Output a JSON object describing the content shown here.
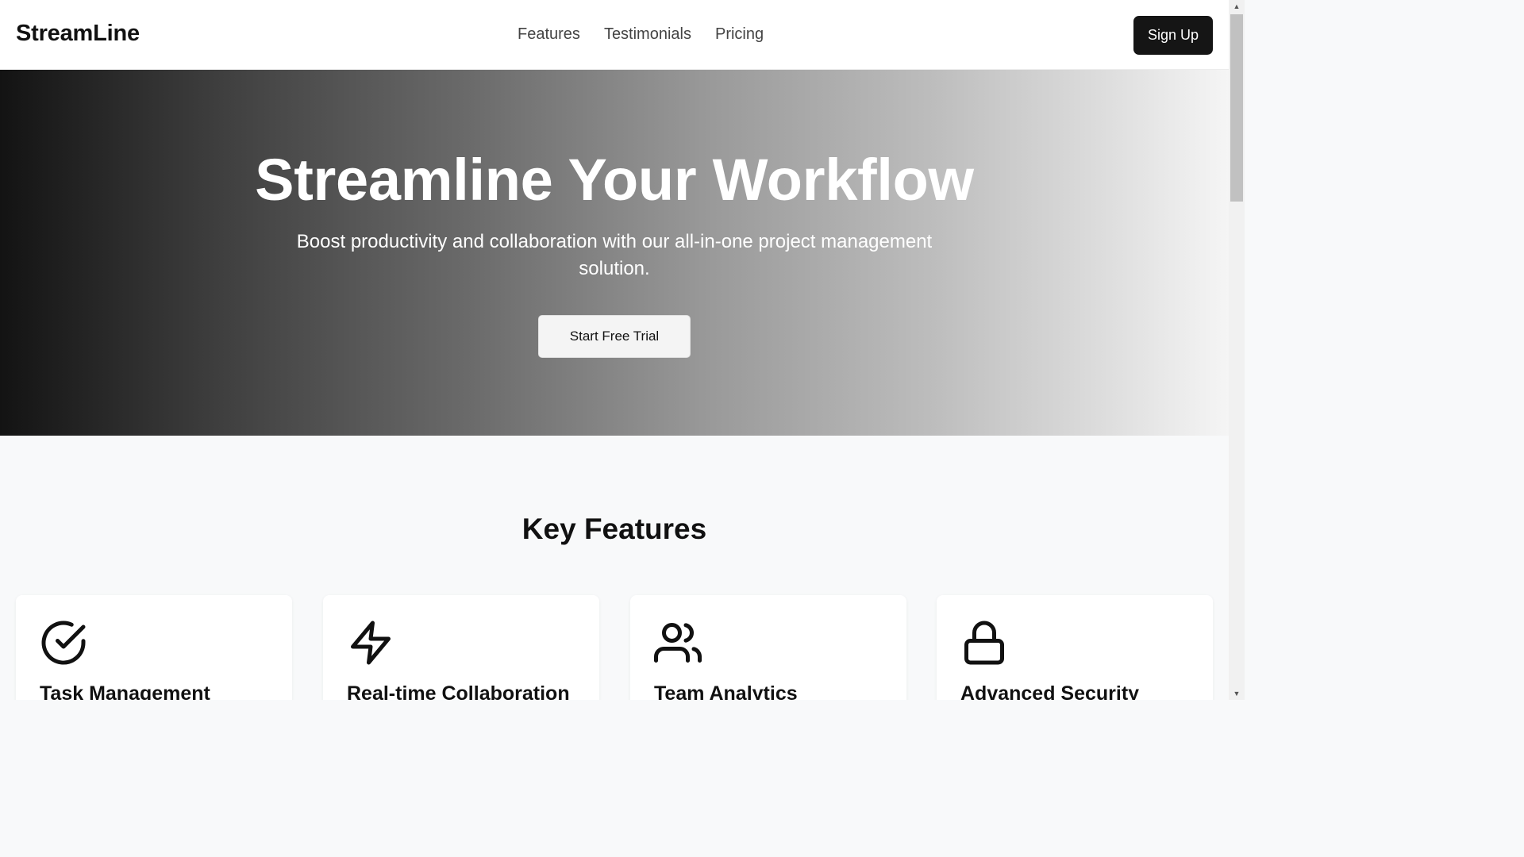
{
  "header": {
    "logo": "StreamLine",
    "nav": [
      "Features",
      "Testimonials",
      "Pricing"
    ],
    "signup_label": "Sign Up"
  },
  "hero": {
    "title": "Streamline Your Workflow",
    "subtitle": "Boost productivity and collaboration with our all-in-one project management solution.",
    "cta_label": "Start Free Trial"
  },
  "features": {
    "title": "Key Features",
    "cards": [
      {
        "title": "Task Management",
        "icon": "check-circle-icon"
      },
      {
        "title": "Real-time Collaboration",
        "icon": "lightning-icon"
      },
      {
        "title": "Team Analytics",
        "icon": "users-icon"
      },
      {
        "title": "Advanced Security",
        "icon": "lock-icon"
      }
    ]
  }
}
